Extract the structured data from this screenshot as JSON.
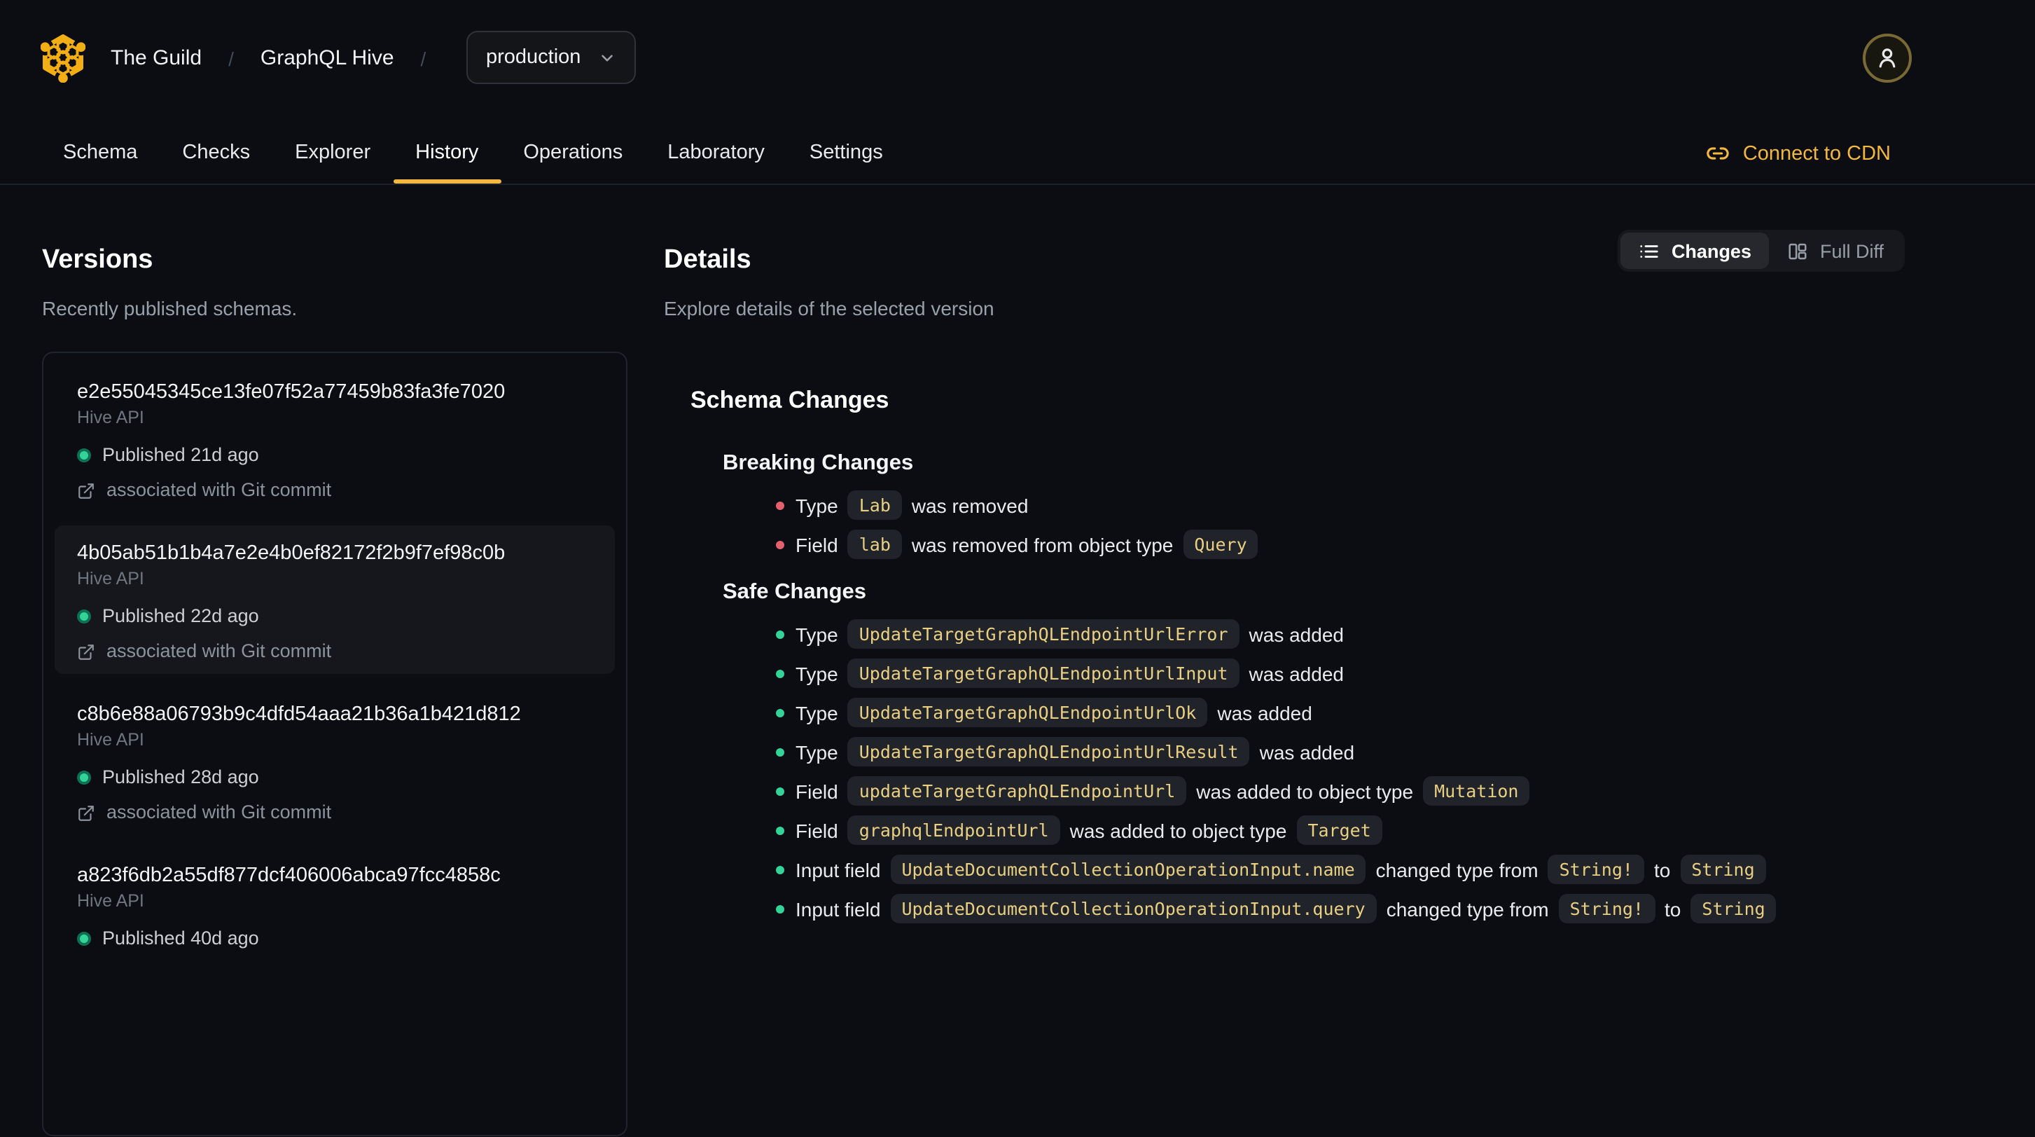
{
  "colors": {
    "background": "#0b0d12",
    "accent_yellow": "#f4b740",
    "logo_gold": "#f3ae14",
    "breaking_red": "#e5606f",
    "safe_green": "#34d399",
    "code_yellow": "#e9cf82"
  },
  "header": {
    "breadcrumb": {
      "org": "The Guild",
      "separator": "/",
      "project": "GraphQL Hive",
      "target_selector": "production"
    },
    "tabs": [
      {
        "label": "Schema",
        "active": false
      },
      {
        "label": "Checks",
        "active": false
      },
      {
        "label": "Explorer",
        "active": false
      },
      {
        "label": "History",
        "active": true
      },
      {
        "label": "Operations",
        "active": false
      },
      {
        "label": "Laboratory",
        "active": false
      },
      {
        "label": "Settings",
        "active": false
      }
    ],
    "connect_cdn_label": "Connect to CDN"
  },
  "versions": {
    "title": "Versions",
    "subtitle": "Recently published schemas.",
    "items": [
      {
        "hash": "e2e55045345ce13fe07f52a77459b83fa3fe7020",
        "service": "Hive API",
        "published": "Published 21d ago",
        "git": "associated with Git commit",
        "selected": false
      },
      {
        "hash": "4b05ab51b1b4a7e2e4b0ef82172f2b9f7ef98c0b",
        "service": "Hive API",
        "published": "Published 22d ago",
        "git": "associated with Git commit",
        "selected": true
      },
      {
        "hash": "c8b6e88a06793b9c4dfd54aaa21b36a1b421d812",
        "service": "Hive API",
        "published": "Published 28d ago",
        "git": "associated with Git commit",
        "selected": false
      },
      {
        "hash": "a823f6db2a55df877dcf406006abca97fcc4858c",
        "service": "Hive API",
        "published": "Published 40d ago",
        "selected": false
      }
    ]
  },
  "details": {
    "title": "Details",
    "subtitle": "Explore details of the selected version",
    "view_toggle": {
      "changes_label": "Changes",
      "full_diff_label": "Full Diff",
      "active": "Changes"
    },
    "schema_changes": {
      "title": "Schema Changes",
      "breaking": {
        "title": "Breaking Changes",
        "items": [
          {
            "parts": [
              {
                "t": "text",
                "v": "Type"
              },
              {
                "t": "code",
                "v": "Lab"
              },
              {
                "t": "text",
                "v": "was removed"
              }
            ]
          },
          {
            "parts": [
              {
                "t": "text",
                "v": "Field"
              },
              {
                "t": "code",
                "v": "lab"
              },
              {
                "t": "text",
                "v": "was removed from object type"
              },
              {
                "t": "code",
                "v": "Query"
              }
            ]
          }
        ]
      },
      "safe": {
        "title": "Safe Changes",
        "items": [
          {
            "parts": [
              {
                "t": "text",
                "v": "Type"
              },
              {
                "t": "code",
                "v": "UpdateTargetGraphQLEndpointUrlError"
              },
              {
                "t": "text",
                "v": "was added"
              }
            ]
          },
          {
            "parts": [
              {
                "t": "text",
                "v": "Type"
              },
              {
                "t": "code",
                "v": "UpdateTargetGraphQLEndpointUrlInput"
              },
              {
                "t": "text",
                "v": "was added"
              }
            ]
          },
          {
            "parts": [
              {
                "t": "text",
                "v": "Type"
              },
              {
                "t": "code",
                "v": "UpdateTargetGraphQLEndpointUrlOk"
              },
              {
                "t": "text",
                "v": "was added"
              }
            ]
          },
          {
            "parts": [
              {
                "t": "text",
                "v": "Type"
              },
              {
                "t": "code",
                "v": "UpdateTargetGraphQLEndpointUrlResult"
              },
              {
                "t": "text",
                "v": "was added"
              }
            ]
          },
          {
            "parts": [
              {
                "t": "text",
                "v": "Field"
              },
              {
                "t": "code",
                "v": "updateTargetGraphQLEndpointUrl"
              },
              {
                "t": "text",
                "v": "was added to object type"
              },
              {
                "t": "code",
                "v": "Mutation"
              }
            ]
          },
          {
            "parts": [
              {
                "t": "text",
                "v": "Field"
              },
              {
                "t": "code",
                "v": "graphqlEndpointUrl"
              },
              {
                "t": "text",
                "v": "was added to object type"
              },
              {
                "t": "code",
                "v": "Target"
              }
            ]
          },
          {
            "parts": [
              {
                "t": "text",
                "v": "Input field"
              },
              {
                "t": "code",
                "v": "UpdateDocumentCollectionOperationInput.name"
              },
              {
                "t": "text",
                "v": "changed type from"
              },
              {
                "t": "code",
                "v": "String!"
              },
              {
                "t": "text",
                "v": "to"
              },
              {
                "t": "code",
                "v": "String"
              }
            ]
          },
          {
            "parts": [
              {
                "t": "text",
                "v": "Input field"
              },
              {
                "t": "code",
                "v": "UpdateDocumentCollectionOperationInput.query"
              },
              {
                "t": "text",
                "v": "changed type from"
              },
              {
                "t": "code",
                "v": "String!"
              },
              {
                "t": "text",
                "v": "to"
              },
              {
                "t": "code",
                "v": "String"
              }
            ]
          }
        ]
      }
    }
  }
}
